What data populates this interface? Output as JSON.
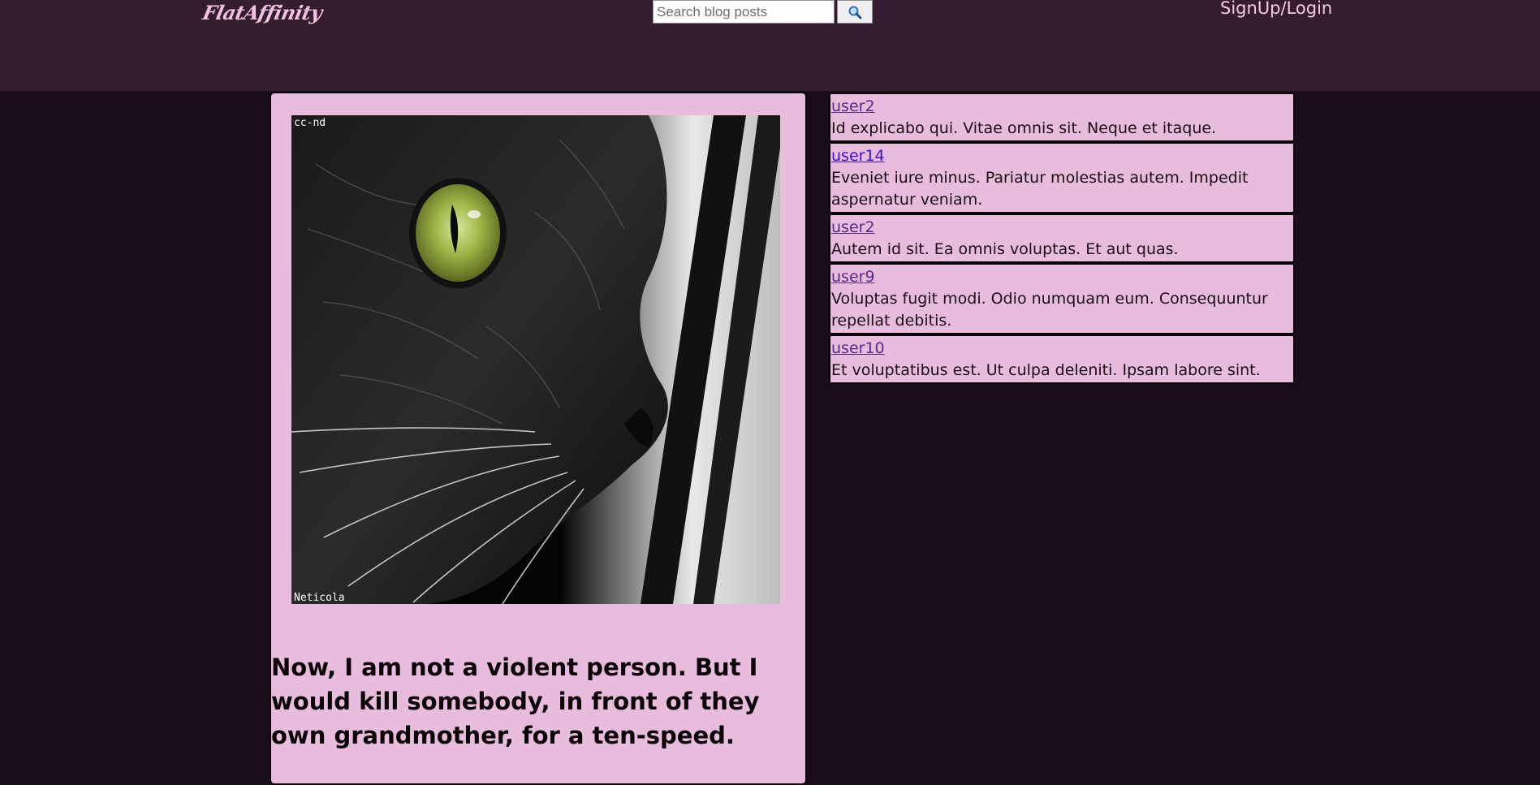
{
  "header": {
    "logo": "FlatAffinity",
    "search_placeholder": "Search blog posts",
    "search_icon": "magnifier-icon",
    "auth_link": "SignUp/Login"
  },
  "post": {
    "title": "Now, I am not a violent person. But I would kill somebody, in front of they own grandmother, for a ten-speed.",
    "image": {
      "subject": "black-cat-closeup",
      "top_watermark": "cc-nd",
      "bottom_watermark": "Neticola"
    }
  },
  "comments": [
    {
      "user": "user2",
      "text": "Id explicabo qui. Vitae omnis sit. Neque et itaque."
    },
    {
      "user": "user14",
      "text": "Eveniet iure minus. Pariatur molestias autem. Impedit aspernatur veniam."
    },
    {
      "user": "user2",
      "text": "Autem id sit. Ea omnis voluptas. Et aut quas."
    },
    {
      "user": "user9",
      "text": "Voluptas fugit modi. Odio numquam eum. Consequuntur repellat debitis."
    },
    {
      "user": "user10",
      "text": "Et voluptatibus est. Ut culpa deleniti. Ipsam labore sint."
    }
  ],
  "colors": {
    "page_bg": "#1b0c1b",
    "header_bg": "#341d2e",
    "card_bg": "#e7bcdc",
    "logo": "#f0bfe2",
    "link": "#3a0fd6",
    "visited_link": "#5b2a86"
  }
}
